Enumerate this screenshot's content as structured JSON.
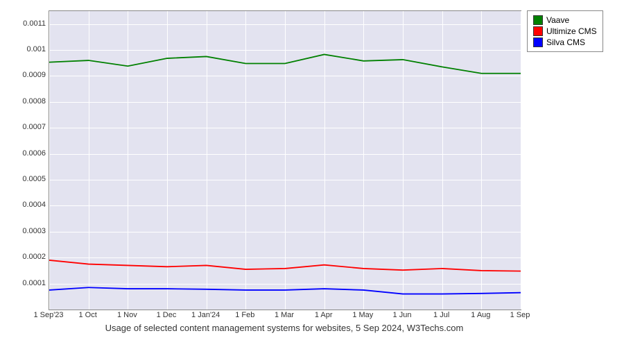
{
  "chart_data": {
    "type": "line",
    "categories": [
      "1 Sep'23",
      "1 Oct",
      "1 Nov",
      "1 Dec",
      "1 Jan'24",
      "1 Feb",
      "1 Mar",
      "1 Apr",
      "1 May",
      "1 Jun",
      "1 Jul",
      "1 Aug",
      "1 Sep"
    ],
    "series": [
      {
        "name": "Vaave",
        "color": "#008000",
        "values": [
          0.000953,
          0.00096,
          0.000938,
          0.000968,
          0.000975,
          0.000948,
          0.000948,
          0.000983,
          0.000958,
          0.000963,
          0.000935,
          0.00091,
          0.00091
        ]
      },
      {
        "name": "Ultimize CMS",
        "color": "#ff0000",
        "values": [
          0.00019,
          0.000175,
          0.00017,
          0.000165,
          0.00017,
          0.000155,
          0.000158,
          0.000172,
          0.000158,
          0.000152,
          0.000158,
          0.00015,
          0.000148
        ]
      },
      {
        "name": "Silva CMS",
        "color": "#0000ff",
        "values": [
          7.5e-05,
          8.5e-05,
          8e-05,
          8e-05,
          7.8e-05,
          7.5e-05,
          7.5e-05,
          8e-05,
          7.5e-05,
          6e-05,
          6e-05,
          6.2e-05,
          6.5e-05
        ]
      }
    ],
    "ylim": [
      0,
      0.00115
    ],
    "yticks": [
      0.0001,
      0.0002,
      0.0003,
      0.0004,
      0.0005,
      0.0006,
      0.0007,
      0.0008,
      0.0009,
      0.001,
      0.0011
    ],
    "caption": "Usage of selected content management systems for websites, 5 Sep 2024, W3Techs.com"
  }
}
